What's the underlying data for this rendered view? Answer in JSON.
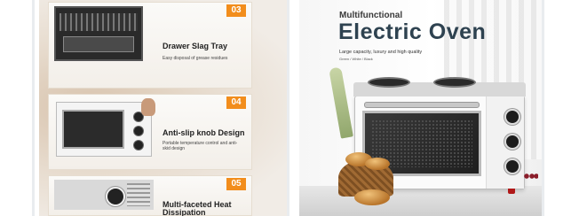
{
  "left_panel": {
    "features": [
      {
        "number": "03",
        "title": "Drawer Slag Tray",
        "description": "Easy disposal of grease residues"
      },
      {
        "number": "04",
        "title": "Anti-slip knob Design",
        "description": "Portable temperature control and anti-skid design"
      },
      {
        "number": "05",
        "title": "Multi-faceted Heat Dissipation",
        "description": ""
      }
    ]
  },
  "right_panel": {
    "subtitle": "Multifunctional",
    "title": "Electric Oven",
    "tagline": "Large capacity, luxury and high quality",
    "colors": "Green / White / Black"
  },
  "colors": {
    "accent": "#f28d1c",
    "title": "#2e4250"
  }
}
